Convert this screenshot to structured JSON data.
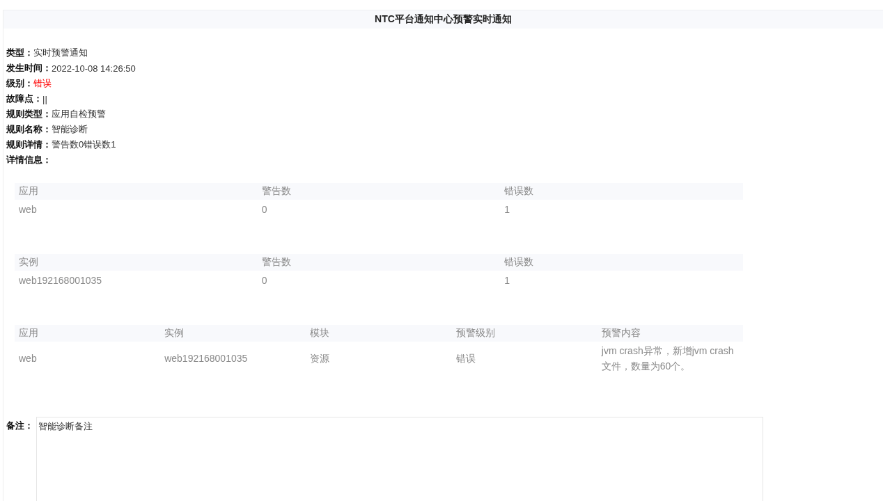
{
  "title": "NTC平台通知中心预警实时通知",
  "fields": [
    {
      "label": "类型：",
      "value": "实时预警通知"
    },
    {
      "label": "发生时间：",
      "value": "2022-10-08 14:26:50"
    },
    {
      "label": "级别：",
      "value": "错误",
      "color": "#ff0000"
    },
    {
      "label": "故障点：",
      "value": "||"
    },
    {
      "label": "规则类型：",
      "value": "应用自检预警"
    },
    {
      "label": "规则名称：",
      "value": "智能诊断"
    },
    {
      "label": "规则详情：",
      "value": "警告数0错误数1"
    },
    {
      "label": "详情信息："
    }
  ],
  "tables": [
    {
      "columns": [
        "应用",
        "警告数",
        "错误数"
      ],
      "rows": [
        [
          "web",
          "0",
          "1"
        ]
      ]
    },
    {
      "columns": [
        "实例",
        "警告数",
        "错误数"
      ],
      "rows": [
        [
          "web192168001035",
          "0",
          "1"
        ]
      ]
    },
    {
      "columns": [
        "应用",
        "实例",
        "模块",
        "预警级别",
        "预警内容"
      ],
      "rows": [
        [
          "web",
          "web192168001035",
          "资源",
          "错误",
          "jvm crash异常，新增jvm crash文件，数量为60个。"
        ]
      ]
    }
  ],
  "remark": {
    "label": "备注：",
    "value": "智能诊断备注"
  }
}
